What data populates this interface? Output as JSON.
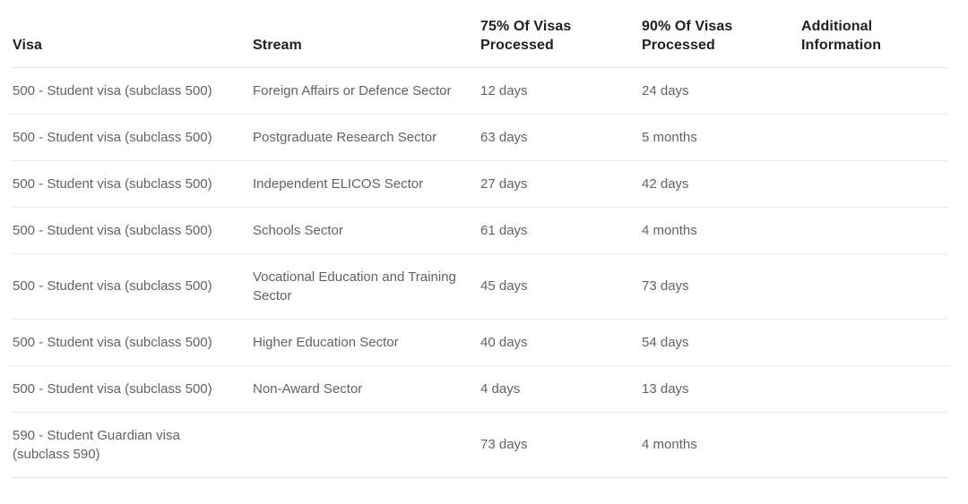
{
  "table": {
    "columns": [
      {
        "key": "visa",
        "label": "Visa"
      },
      {
        "key": "stream",
        "label": "Stream"
      },
      {
        "key": "p75",
        "label": "75% Of Visas Processed"
      },
      {
        "key": "p90",
        "label": "90% Of Visas Processed"
      },
      {
        "key": "additional",
        "label": "Additional Information"
      }
    ],
    "header_lines": {
      "visa": [
        "Visa"
      ],
      "stream": [
        "Stream"
      ],
      "p75": [
        "75% Of Visas",
        "Processed"
      ],
      "p90": [
        "90% Of Visas",
        "Processed"
      ],
      "additional": [
        "Additional",
        "Information"
      ]
    },
    "rows": [
      {
        "visa": "500 - Student visa (subclass 500)",
        "stream": "Foreign Affairs or Defence Sector",
        "p75": "12 days",
        "p90": "24 days",
        "additional": ""
      },
      {
        "visa": "500 - Student visa (subclass 500)",
        "stream": "Postgraduate Research Sector",
        "p75": "63 days",
        "p90": "5 months",
        "additional": ""
      },
      {
        "visa": "500 - Student visa (subclass 500)",
        "stream": "Independent ELICOS Sector",
        "p75": "27 days",
        "p90": "42 days",
        "additional": ""
      },
      {
        "visa": "500 - Student visa (subclass 500)",
        "stream": "Schools Sector",
        "p75": "61 days",
        "p90": "4 months",
        "additional": ""
      },
      {
        "visa": "500 - Student visa (subclass 500)",
        "stream": "Vocational Education and Training Sector",
        "p75": "45 days",
        "p90": "73 days",
        "additional": ""
      },
      {
        "visa": "500 - Student visa (subclass 500)",
        "stream": "Higher Education Sector",
        "p75": "40 days",
        "p90": "54 days",
        "additional": ""
      },
      {
        "visa": "500 - Student visa (subclass 500)",
        "stream": "Non-Award Sector",
        "p75": "4 days",
        "p90": "13 days",
        "additional": ""
      },
      {
        "visa": "590 - Student Guardian visa (subclass 590)",
        "stream": "",
        "p75": "73 days",
        "p90": "4 months",
        "additional": ""
      }
    ]
  },
  "colors": {
    "page_background": "#ffffff",
    "header_text": "#202124",
    "body_text": "#5f6368",
    "row_divider": "#eceded",
    "header_divider": "#e4e5e7"
  }
}
